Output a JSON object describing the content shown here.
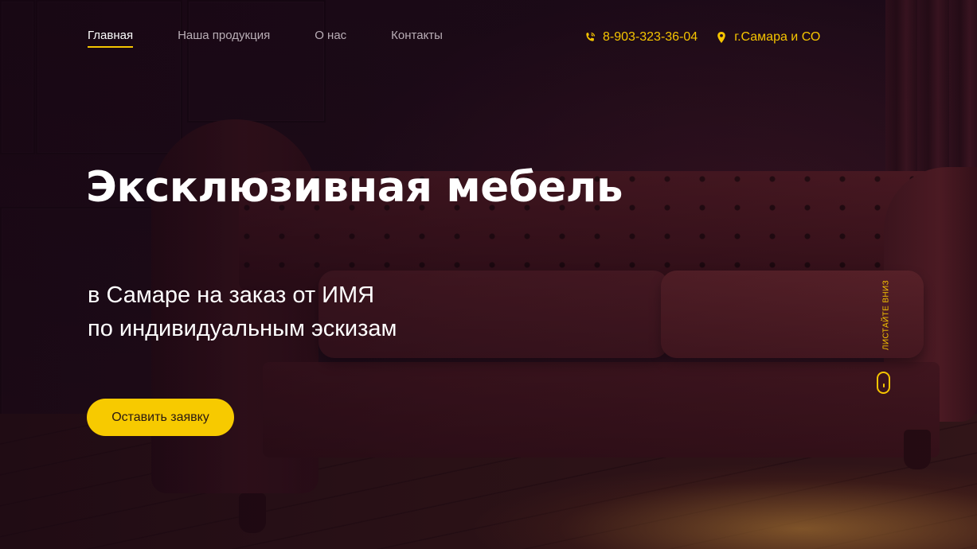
{
  "nav": {
    "items": [
      {
        "label": "Главная",
        "active": true
      },
      {
        "label": "Наша продукция",
        "active": false
      },
      {
        "label": "О нас",
        "active": false
      },
      {
        "label": "Контакты",
        "active": false
      }
    ]
  },
  "contacts": {
    "phone": "8-903-323-36-04",
    "phone_icon": "phone-icon",
    "location": "г.Самара и СО",
    "location_icon": "map-pin-icon"
  },
  "hero": {
    "title": "Эксклюзивная мебель",
    "subtitle_line1": "в Самаре на заказ от ИМЯ",
    "subtitle_line2": "по индивидуальным эскизам",
    "cta_label": "Оставить заявку"
  },
  "scroll_hint": {
    "label": "ЛИСТАЙТЕ ВНИЗ",
    "icon": "mouse-icon"
  },
  "colors": {
    "accent": "#f6c500",
    "text": "#ffffff",
    "nav_inactive": "#b9aeb6"
  }
}
